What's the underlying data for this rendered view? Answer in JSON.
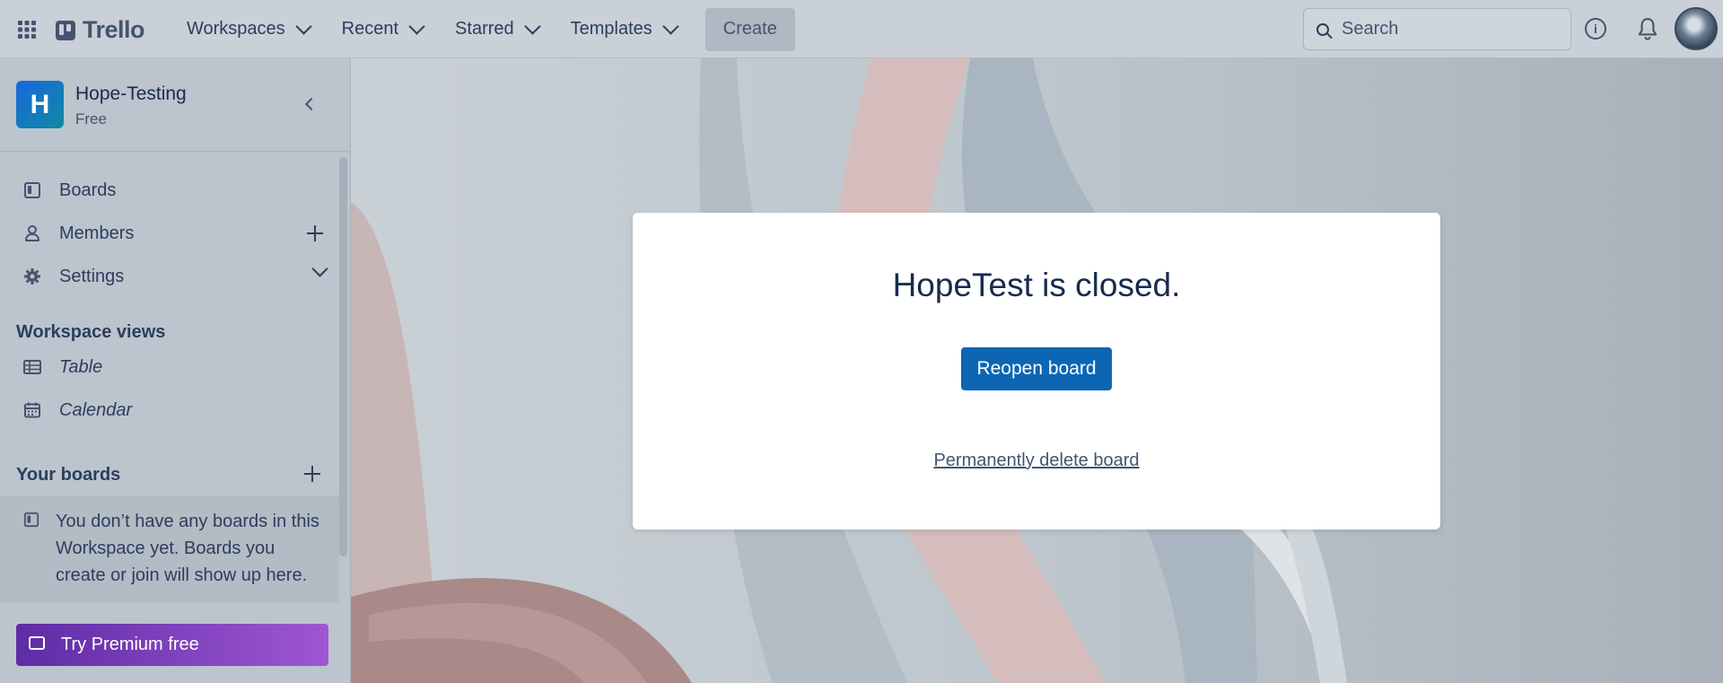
{
  "header": {
    "brand": "Trello",
    "nav": [
      {
        "label": "Workspaces"
      },
      {
        "label": "Recent"
      },
      {
        "label": "Starred"
      },
      {
        "label": "Templates"
      }
    ],
    "create_label": "Create",
    "search_placeholder": "Search"
  },
  "sidebar": {
    "workspace": {
      "initial": "H",
      "name": "Hope-Testing",
      "plan": "Free"
    },
    "items": [
      {
        "label": "Boards",
        "icon": "board-icon"
      },
      {
        "label": "Members",
        "icon": "person-icon"
      },
      {
        "label": "Settings",
        "icon": "gear-icon"
      }
    ],
    "views_title": "Workspace views",
    "views": [
      {
        "label": "Table",
        "icon": "table-icon"
      },
      {
        "label": "Calendar",
        "icon": "calendar-icon"
      }
    ],
    "boards_title": "Your boards",
    "empty_message": "You don’t have any boards in this Workspace yet. Boards you create or join will show up here.",
    "premium_label": "Try Premium free"
  },
  "modal": {
    "title": "HopeTest is closed.",
    "reopen_label": "Reopen board",
    "delete_label": "Permanently delete board"
  },
  "colors": {
    "primary_button": "#0c66b4",
    "premium_gradient_start": "#5e2ca5",
    "premium_gradient_end": "#9f56d2",
    "workspace_avatar": "#1868db"
  }
}
